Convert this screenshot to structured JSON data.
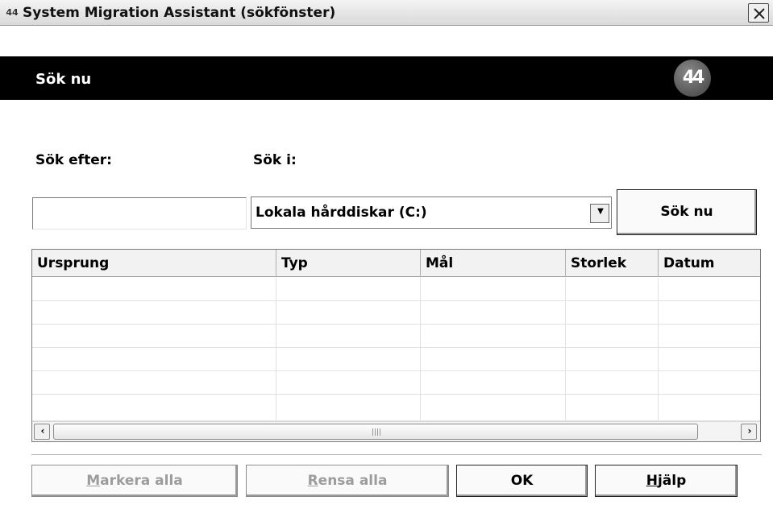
{
  "window": {
    "title": "System Migration Assistant (sökfönster)",
    "app_icon": "44"
  },
  "header": {
    "title": "Sök nu",
    "logo_text": "44"
  },
  "form": {
    "search_for_label": "Sök efter:",
    "search_in_label": "Sök i:",
    "search_value": "",
    "location_value": "Lokala hårddiskar (C:)",
    "search_button": "Sök nu"
  },
  "table": {
    "columns": [
      "Ursprung",
      "Typ",
      "Mål",
      "Storlek",
      "Datum"
    ],
    "rows": []
  },
  "buttons": {
    "select_all": {
      "accel": "M",
      "rest": "arkera alla"
    },
    "clear_all": {
      "accel": "R",
      "rest": "ensa alla"
    },
    "ok": "OK",
    "help": {
      "accel": "H",
      "rest": "jälp"
    }
  }
}
